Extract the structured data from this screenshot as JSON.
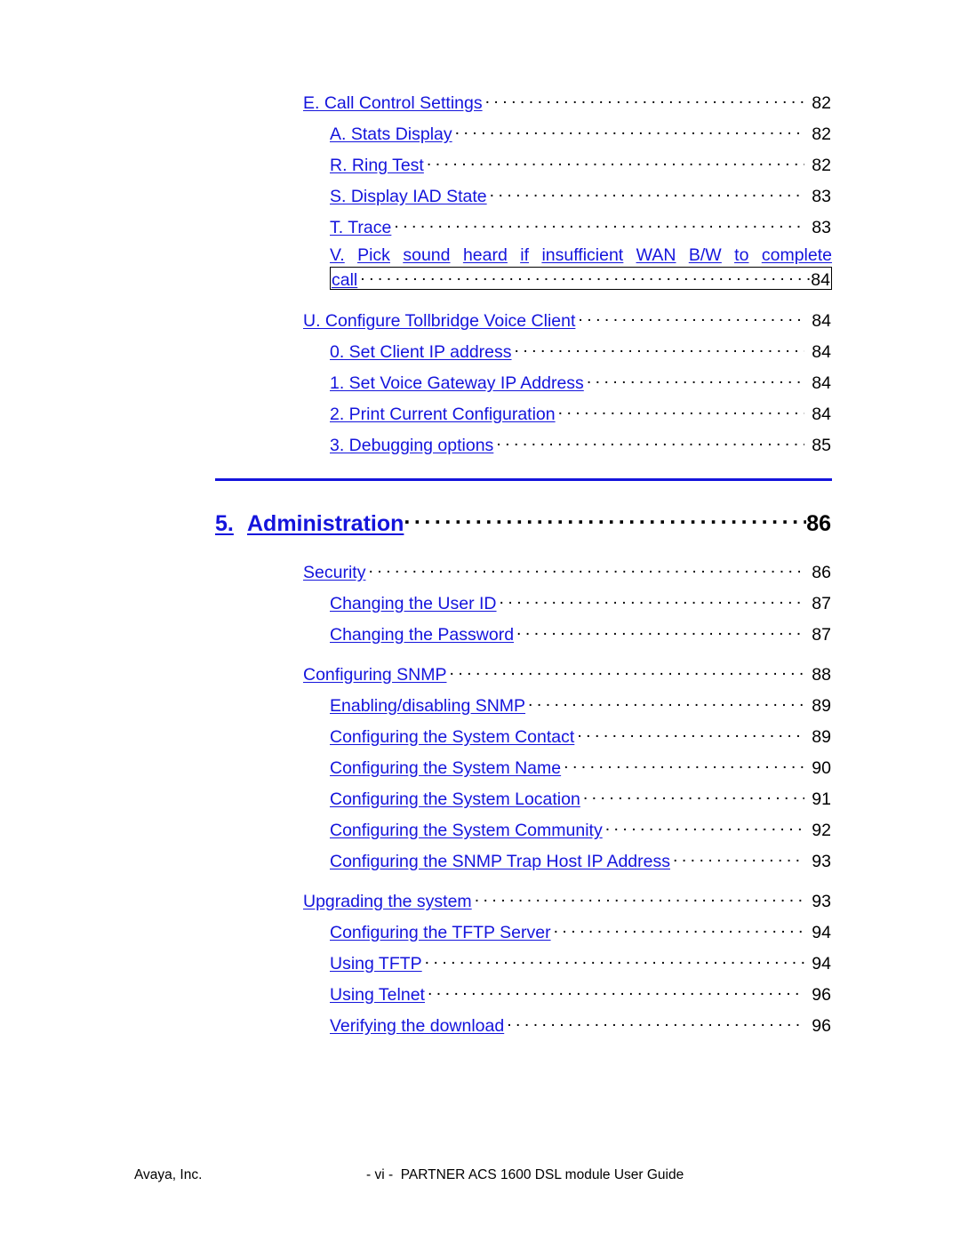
{
  "document": {
    "type": "table-of-contents",
    "link_color": "#1414dc",
    "page_number_color": "#000000",
    "leader_character": "."
  },
  "toc": {
    "group_1": [
      {
        "level": 2,
        "label": "E. Call Control Settings",
        "page": "82"
      },
      {
        "level": 3,
        "label": "A. Stats Display",
        "page": "82"
      },
      {
        "level": 3,
        "label": "R. Ring Test",
        "page": "82"
      },
      {
        "level": 3,
        "label": "S. Display IAD State",
        "page": "83"
      },
      {
        "level": 3,
        "label": "T. Trace",
        "page": "83"
      }
    ],
    "wrapped_entry": {
      "level": 3,
      "line1": "V. Pick sound heard if insufficient WAN B/W to complete",
      "line2": "call",
      "page": "84",
      "selected": true,
      "full_label": "V. Pick sound heard if insufficient WAN B/W to complete call"
    },
    "group_2": [
      {
        "level": 2,
        "label": "U. Configure Tollbridge Voice Client",
        "page": "84"
      },
      {
        "level": 3,
        "label": "0. Set Client IP address",
        "page": "84"
      },
      {
        "level": 3,
        "label": "1. Set Voice Gateway IP Address",
        "page": "84"
      },
      {
        "level": 3,
        "label": "2. Print Current Configuration",
        "page": "84"
      },
      {
        "level": 3,
        "label": "3. Debugging options",
        "page": "85"
      }
    ],
    "chapter": {
      "number": "5.",
      "title": "Administration",
      "page": "86"
    },
    "group_3": [
      {
        "level": 2,
        "label": "Security",
        "page": "86"
      },
      {
        "level": 3,
        "label": "Changing the User ID",
        "page": "87"
      },
      {
        "level": 3,
        "label": "Changing the Password",
        "page": "87"
      }
    ],
    "group_4": [
      {
        "level": 2,
        "label": "Configuring SNMP",
        "page": "88"
      },
      {
        "level": 3,
        "label": "Enabling/disabling SNMP",
        "page": "89"
      },
      {
        "level": 3,
        "label": "Configuring the System Contact",
        "page": "89"
      },
      {
        "level": 3,
        "label": "Configuring the System Name",
        "page": "90"
      },
      {
        "level": 3,
        "label": "Configuring the System Location",
        "page": "91"
      },
      {
        "level": 3,
        "label": "Configuring the System Community",
        "page": "92"
      },
      {
        "level": 3,
        "label": "Configuring the SNMP Trap Host IP Address",
        "page": "93"
      }
    ],
    "group_5": [
      {
        "level": 2,
        "label": "Upgrading the system",
        "page": "93"
      },
      {
        "level": 3,
        "label": "Configuring the TFTP Server",
        "page": "94"
      },
      {
        "level": 3,
        "label": "Using TFTP",
        "page": "94"
      },
      {
        "level": 3,
        "label": "Using Telnet",
        "page": "96"
      },
      {
        "level": 3,
        "label": "Verifying the download",
        "page": "96"
      }
    ]
  },
  "footer": {
    "company": "Avaya, Inc.",
    "page_marker_and_title": "- vi -  PARTNER ACS 1600 DSL module User Guide"
  }
}
